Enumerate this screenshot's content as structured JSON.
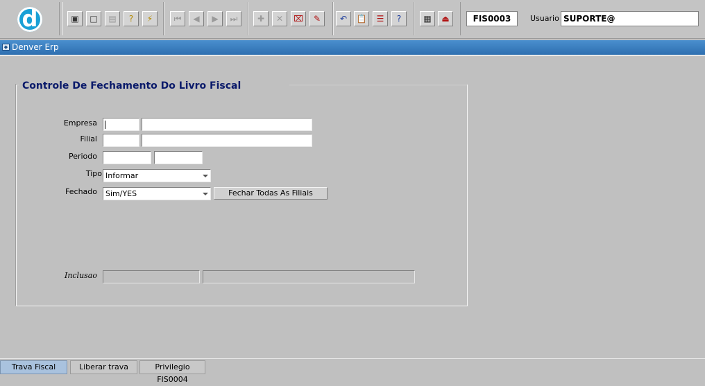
{
  "toolbar": {
    "logo_letter": "d",
    "groups": [
      {
        "items": [
          {
            "icon": "save-icon",
            "glyph": "▣",
            "state": "normal"
          },
          {
            "icon": "window-icon",
            "glyph": "□",
            "state": "normal"
          },
          {
            "icon": "print-icon",
            "glyph": "▤",
            "state": "disabled"
          },
          {
            "icon": "query-help-icon",
            "glyph": "?",
            "state": "yellow"
          },
          {
            "icon": "execute-query-icon",
            "glyph": "⚡",
            "state": "yellow"
          }
        ]
      },
      {
        "items": [
          {
            "icon": "first-record-icon",
            "glyph": "⏮",
            "state": "disabled"
          },
          {
            "icon": "previous-record-icon",
            "glyph": "◀",
            "state": "disabled"
          },
          {
            "icon": "next-record-icon",
            "glyph": "▶",
            "state": "disabled"
          },
          {
            "icon": "last-record-icon",
            "glyph": "⏭",
            "state": "disabled"
          }
        ]
      },
      {
        "items": [
          {
            "icon": "insert-record-icon",
            "glyph": "✚",
            "state": "disabled"
          },
          {
            "icon": "delete-record-icon",
            "glyph": "✕",
            "state": "disabled"
          },
          {
            "icon": "clear-form-icon",
            "glyph": "⌧",
            "state": "red"
          },
          {
            "icon": "edit-icon",
            "glyph": "✎",
            "state": "red"
          }
        ]
      },
      {
        "items": [
          {
            "icon": "undo-icon",
            "glyph": "↶",
            "state": "blue"
          },
          {
            "icon": "clipboard-icon",
            "glyph": "📋",
            "state": "disabled"
          },
          {
            "icon": "list-values-icon",
            "glyph": "☰",
            "state": "red"
          },
          {
            "icon": "help-icon",
            "glyph": "?",
            "state": "blue"
          }
        ]
      },
      {
        "items": [
          {
            "icon": "menu-icon",
            "glyph": "▦",
            "state": "normal"
          },
          {
            "icon": "exit-icon",
            "glyph": "⏏",
            "state": "red"
          }
        ]
      }
    ],
    "program_code": "FIS0003",
    "user_label": "Usuario",
    "user_value": "SUPORTE@"
  },
  "window": {
    "title": "Denver Erp"
  },
  "form": {
    "frame_title": "Controle De Fechamento Do Livro Fiscal",
    "labels": {
      "empresa": "Empresa",
      "filial": "Filial",
      "periodo": "Periodo",
      "tipo": "Tipo",
      "fechado": "Fechado",
      "inclusao": "Inclusao"
    },
    "values": {
      "empresa_code": "",
      "empresa_name": "",
      "filial_code": "",
      "filial_name": "",
      "periodo_start": "",
      "periodo_end": "",
      "tipo": "Informar",
      "fechado": "Sim/YES",
      "inclusao_user": "",
      "inclusao_date": ""
    },
    "fechar_button": "Fechar Todas As Filiais"
  },
  "tabs": [
    {
      "label": "Trava Fiscal",
      "active": true
    },
    {
      "label": "Liberar trava",
      "active": false
    },
    {
      "label": "Privilegio FIS0004",
      "active": false
    }
  ]
}
